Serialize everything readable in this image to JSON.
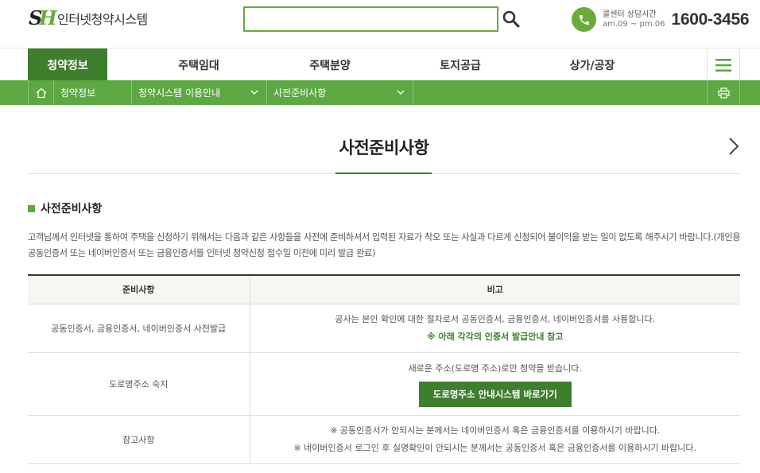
{
  "header": {
    "logo_mark_s": "S",
    "logo_mark_h": "H",
    "logo_text": "인터넷청약시스템",
    "search_placeholder": "",
    "call_label": "콜센터 상담시간",
    "call_hours": "am.09 ~ pm.06",
    "call_number": "1600-3456"
  },
  "nav": {
    "items": [
      "청약정보",
      "주택임대",
      "주택분양",
      "토지공급",
      "상가/공장"
    ],
    "active_index": 0
  },
  "subnav": {
    "level1": "청약정보",
    "level2": "청약시스템 이용안내",
    "level3": "사전준비사항"
  },
  "page": {
    "title": "사전준비사항",
    "section_title": "사전준비사항",
    "intro": "고객님께서 인터넷을 통하여 주택을 신청하기 위해서는 다음과 같은 사항들을 사전에 준비하셔서 입력된 자료가 착오 또는 사실과 다르게 신청되어 불이익을 받는 일이 없도록 해주시기 바랍니다.(개인용 공동인증서 또는 네이버인증서 또는 금융인증서를 인터넷 청약신청 접수일 이전에 미리 발급 완료)"
  },
  "table": {
    "headers": [
      "준비사항",
      "비고"
    ],
    "rows": [
      {
        "item": "공동인증서, 금융인증서, 네이버인증서 사전발급",
        "note": "공사는 본인 확인에 대한 절차로서 공동인증서, 금융인증서, 네이버인증서를 사용합니다.",
        "note_green": "※ 아래 각각의 인증서 발급안내 참고"
      },
      {
        "item": "도로명주소 숙지",
        "note": "새로운 주소(도로명 주소)로만 청약을 받습니다.",
        "button": "도로명주소 안내시스템 바로가기"
      },
      {
        "item": "참고사항",
        "note1": "※ 공동인증서가 안되시는 분께서는 네이버인증서 혹은 금융인증서를 이용하시기 바랍니다.",
        "note2": "※ 네이버인증서 로그인 후 실명확인이 안되시는 분께서는 공동인증서 혹은 금융인증서를 이용하시기 바랍니다."
      }
    ]
  },
  "colors": {
    "brand_green": "#5ea843",
    "dark_green": "#3f7d2f",
    "logo_green": "#6aaa3a"
  }
}
